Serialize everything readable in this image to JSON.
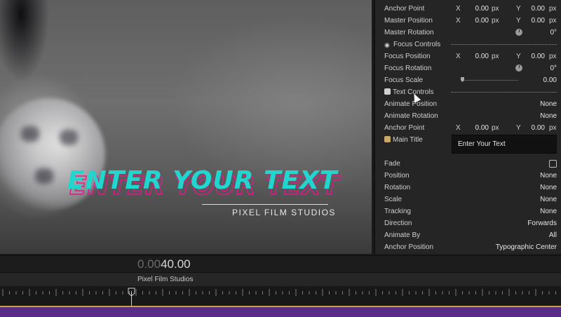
{
  "viewer": {
    "title_text": "ENTER YOUR TEXT",
    "subtitle_text": "PIXEL FILM STUDIOS"
  },
  "inspector": {
    "rows": [
      {
        "label": "Anchor Point",
        "x_axis": "X",
        "x_value": "0.00",
        "x_unit": "px",
        "y_axis": "Y",
        "y_value": "0.00",
        "y_unit": "px"
      },
      {
        "label": "Master Position",
        "x_axis": "X",
        "x_value": "0.00",
        "x_unit": "px",
        "y_axis": "Y",
        "y_value": "0.00",
        "y_unit": "px"
      },
      {
        "label": "Master Rotation",
        "value": "0°"
      },
      {
        "label": "Focus Controls"
      },
      {
        "label": "Focus Position",
        "x_axis": "X",
        "x_value": "0.00",
        "x_unit": "px",
        "y_axis": "Y",
        "y_value": "0.00",
        "y_unit": "px"
      },
      {
        "label": "Focus Rotation",
        "value": "0°"
      },
      {
        "label": "Focus Scale",
        "value": "0.00",
        "slider_level": 0
      },
      {
        "label": "Text Controls"
      },
      {
        "label": "Animate Position",
        "value": "None"
      },
      {
        "label": "Animate Rotation",
        "value": "None"
      },
      {
        "label": "Anchor Point",
        "x_axis": "X",
        "x_value": "0.00",
        "x_unit": "px",
        "y_axis": "Y",
        "y_value": "0.00",
        "y_unit": "px"
      },
      {
        "label": "Main Title",
        "field_value": "Enter Your Text"
      },
      {
        "label": "Fade",
        "checked": false
      },
      {
        "label": "Position",
        "value": "None"
      },
      {
        "label": "Rotation",
        "value": "None"
      },
      {
        "label": "Scale",
        "value": "None"
      },
      {
        "label": "Tracking",
        "value": "None"
      },
      {
        "label": "Direction",
        "value": "Forwards"
      },
      {
        "label": "Animate By",
        "value": "All"
      },
      {
        "label": "Anchor Position",
        "value": "Typographic Center"
      }
    ]
  },
  "timeline": {
    "timecode_dim": "0.00",
    "timecode_lit": "40.00",
    "clip_name": "Pixel Film Studios"
  },
  "colors": {
    "title_fill": "#22d6d0",
    "title_outline": "#e0188a",
    "track": "#5a2c8a",
    "track_edge": "#c9a23a"
  }
}
